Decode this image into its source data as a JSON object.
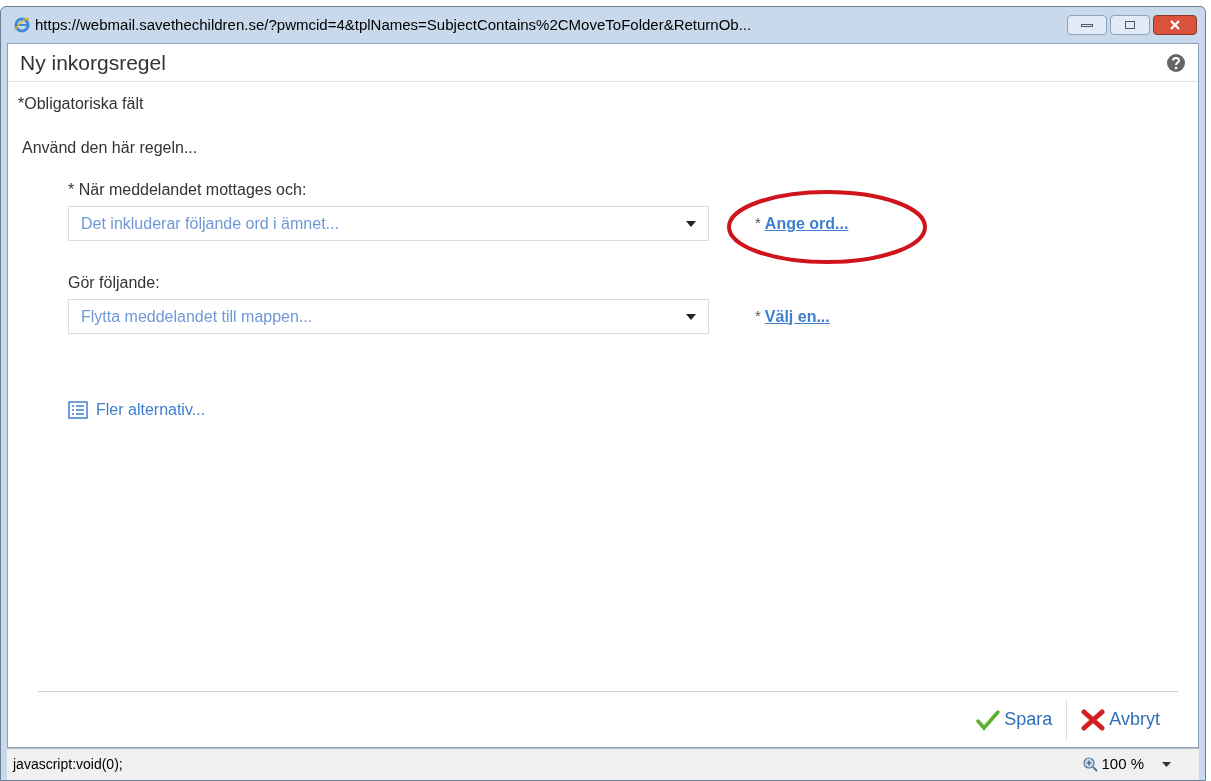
{
  "window": {
    "url": "https://webmail.savethechildren.se/?pwmcid=4&tplNames=SubjectContains%2CMoveToFolder&ReturnOb..."
  },
  "dialog": {
    "title": "Ny inkorgsregel",
    "required_note": "*Obligatoriska fält",
    "intro": "Använd den här regeln...",
    "sections": [
      {
        "label": "* När meddelandet mottages och:",
        "value": "Det inkluderar följande ord i ämnet...",
        "link_prefix": "*",
        "link": "Ange ord...",
        "circled": true
      },
      {
        "label": "Gör följande:",
        "value": "Flytta meddelandet till mappen...",
        "link_prefix": "*",
        "link": "Välj en...",
        "circled": false
      }
    ],
    "more_options": "Fler alternativ...",
    "buttons": [
      {
        "kind": "save",
        "label": "Spara"
      },
      {
        "kind": "cancel",
        "label": "Avbryt"
      }
    ]
  },
  "status_bar": {
    "text": "javascript:void(0);",
    "zoom": "100 %"
  }
}
